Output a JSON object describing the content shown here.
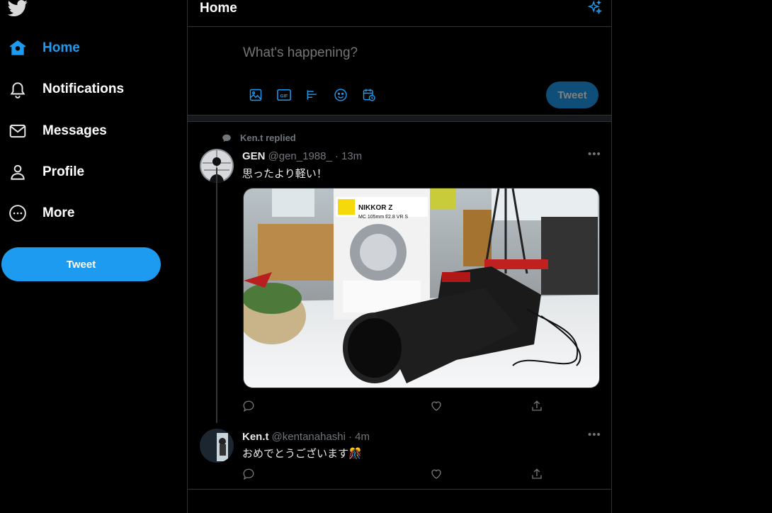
{
  "sidebar": {
    "logo": "twitter-bird-icon",
    "items": [
      {
        "label": "Home",
        "icon": "home-icon",
        "active": true
      },
      {
        "label": "Notifications",
        "icon": "bell-icon"
      },
      {
        "label": "Messages",
        "icon": "envelope-icon"
      },
      {
        "label": "Profile",
        "icon": "person-icon"
      },
      {
        "label": "More",
        "icon": "more-circle-icon"
      }
    ],
    "tweet_button": "Tweet"
  },
  "header": {
    "title": "Home",
    "sparkle_icon": "sparkle-icon"
  },
  "composer": {
    "placeholder": "What's happening?",
    "tools": [
      "image-icon",
      "gif-icon",
      "poll-icon",
      "emoji-icon",
      "schedule-icon"
    ],
    "button": "Tweet"
  },
  "thread": {
    "context": "Ken.t replied",
    "tweets": [
      {
        "name": "GEN",
        "handle": "@gen_1988_",
        "time": "· 13m",
        "text": "思ったより軽い！",
        "media": "nikon-camera-photo"
      },
      {
        "name": "Ken.t",
        "handle": "@kentanahashi",
        "time": "· 4m",
        "text": "おめでとうございます🎊"
      }
    ]
  },
  "colors": {
    "accent": "#1d9bf0",
    "background": "#000000",
    "border": "#2f3336",
    "muted": "#71767b"
  }
}
